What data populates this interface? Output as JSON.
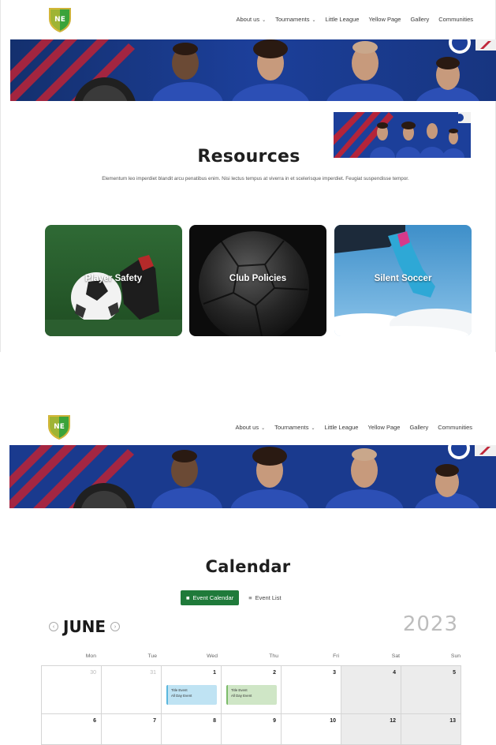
{
  "nav": [
    {
      "label": "About us",
      "caret": true
    },
    {
      "label": "Tournaments",
      "caret": true
    },
    {
      "label": "Little League",
      "caret": false
    },
    {
      "label": "Yellow Page",
      "caret": false
    },
    {
      "label": "Gallery",
      "caret": false
    },
    {
      "label": "Communities",
      "caret": false
    }
  ],
  "logo_text": "NE",
  "resources": {
    "title": "Resources",
    "description": "Elementum leo imperdiet blandit arcu penatibus enim. Nisi lectus tempus at viverra in et scelerisque imperdiet. Feugiat suspendisse tempor.",
    "cards": [
      {
        "label": "Player Safety"
      },
      {
        "label": "Club Policies"
      },
      {
        "label": "Silent Soccer"
      }
    ]
  },
  "calendar": {
    "title": "Calendar",
    "event_calendar_label": "Event Calendar",
    "event_list_label": "Event List",
    "month": "JUNE",
    "year": "2023",
    "weekdays": [
      "Mon",
      "Tue",
      "Wed",
      "Thu",
      "Fri",
      "Sat",
      "Sun"
    ],
    "weeks": [
      [
        {
          "num": "30",
          "dim": true
        },
        {
          "num": "31",
          "dim": true
        },
        {
          "num": "1",
          "event": {
            "color": "blue",
            "line1": "Title Event",
            "line2": "All Day Event"
          }
        },
        {
          "num": "2",
          "event": {
            "color": "green",
            "line1": "Title Event",
            "line2": "All Day Event"
          }
        },
        {
          "num": "3"
        },
        {
          "num": "4",
          "weekend": true
        },
        {
          "num": "5",
          "weekend": true
        }
      ],
      [
        {
          "num": "6"
        },
        {
          "num": "7"
        },
        {
          "num": "8"
        },
        {
          "num": "9"
        },
        {
          "num": "10"
        },
        {
          "num": "12",
          "weekend": true
        },
        {
          "num": "13",
          "weekend": true
        }
      ]
    ]
  },
  "colors": {
    "accent_green": "#1f7a3a",
    "banner_blue": "#1c3f9a",
    "stripe_red": "#b3243a",
    "weekend_bg": "#ececec"
  }
}
